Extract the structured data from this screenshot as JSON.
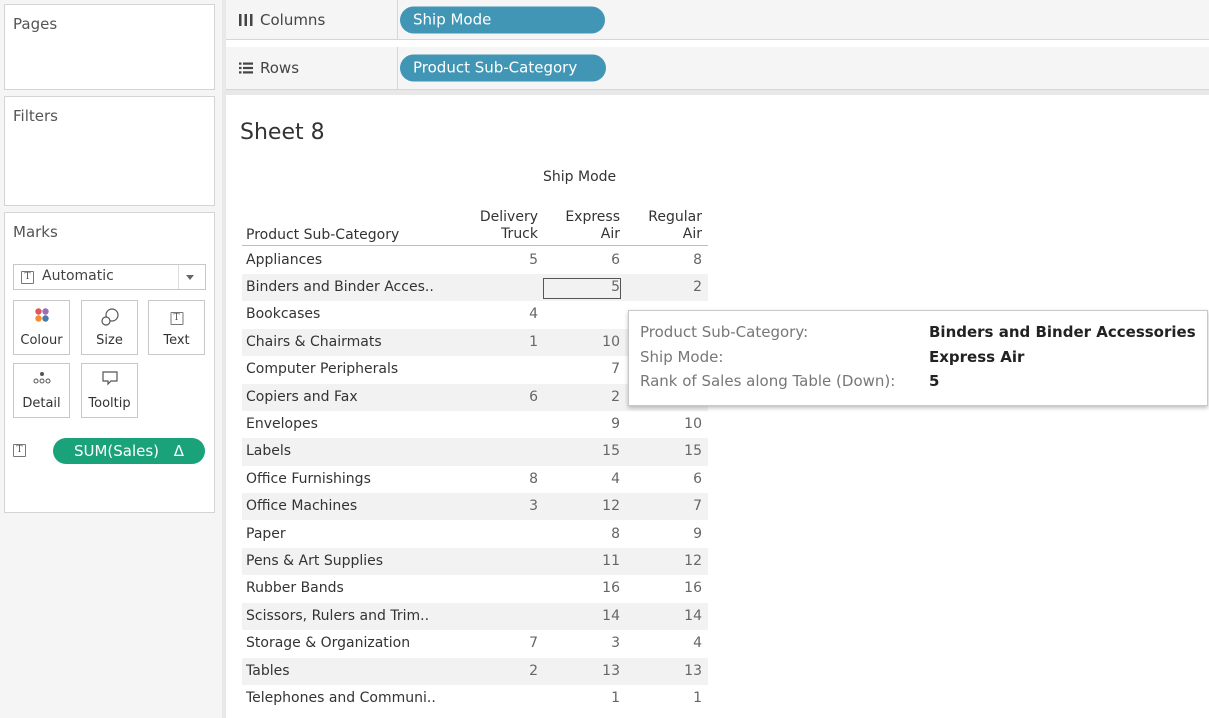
{
  "cards": {
    "pages": "Pages",
    "filters": "Filters",
    "marks": "Marks"
  },
  "marks": {
    "type": "Automatic",
    "buttons": [
      "Colour",
      "Size",
      "Text",
      "Detail",
      "Tooltip"
    ],
    "pill": "SUM(Sales)",
    "pill_symbol": "Δ",
    "pill_color": "#1aa37a"
  },
  "shelves": {
    "columns_label": "Columns",
    "columns_pill": "Ship Mode",
    "rows_label": "Rows",
    "rows_pill": "Product Sub-Category",
    "pill_color": "#4196b5"
  },
  "sheet": {
    "title": "Sheet 8",
    "column_group": "Ship Mode",
    "row_header": "Product Sub-Category",
    "columns": [
      {
        "line1": "Delivery",
        "line2": "Truck"
      },
      {
        "line1": "Express",
        "line2": "Air"
      },
      {
        "line1": "Regular",
        "line2": "Air"
      }
    ],
    "rows": [
      {
        "label": "Appliances",
        "values": [
          "5",
          "6",
          "8"
        ]
      },
      {
        "label": "Binders and Binder Acces..",
        "values": [
          "",
          "5",
          "2"
        ]
      },
      {
        "label": "Bookcases",
        "values": [
          "4",
          "",
          ""
        ]
      },
      {
        "label": "Chairs & Chairmats",
        "values": [
          "1",
          "10",
          ""
        ]
      },
      {
        "label": "Computer Peripherals",
        "values": [
          "",
          "7",
          ""
        ]
      },
      {
        "label": "Copiers and Fax",
        "values": [
          "6",
          "2",
          ""
        ]
      },
      {
        "label": "Envelopes",
        "values": [
          "",
          "9",
          "10"
        ]
      },
      {
        "label": "Labels",
        "values": [
          "",
          "15",
          "15"
        ]
      },
      {
        "label": "Office Furnishings",
        "values": [
          "8",
          "4",
          "6"
        ]
      },
      {
        "label": "Office Machines",
        "values": [
          "3",
          "12",
          "7"
        ]
      },
      {
        "label": "Paper",
        "values": [
          "",
          "8",
          "9"
        ]
      },
      {
        "label": "Pens & Art Supplies",
        "values": [
          "",
          "11",
          "12"
        ]
      },
      {
        "label": "Rubber Bands",
        "values": [
          "",
          "16",
          "16"
        ]
      },
      {
        "label": "Scissors, Rulers and Trim..",
        "values": [
          "",
          "14",
          "14"
        ]
      },
      {
        "label": "Storage & Organization",
        "values": [
          "7",
          "3",
          "4"
        ]
      },
      {
        "label": "Tables",
        "values": [
          "2",
          "13",
          "13"
        ]
      },
      {
        "label": "Telephones and Communi..",
        "values": [
          "",
          "1",
          "1"
        ]
      }
    ]
  },
  "tooltip": {
    "k1": "Product Sub-Category:",
    "v1": "Binders and Binder Accessories",
    "k2": "Ship Mode:",
    "v2": "Express Air",
    "k3": "Rank of Sales along Table (Down):",
    "v3": "5"
  }
}
